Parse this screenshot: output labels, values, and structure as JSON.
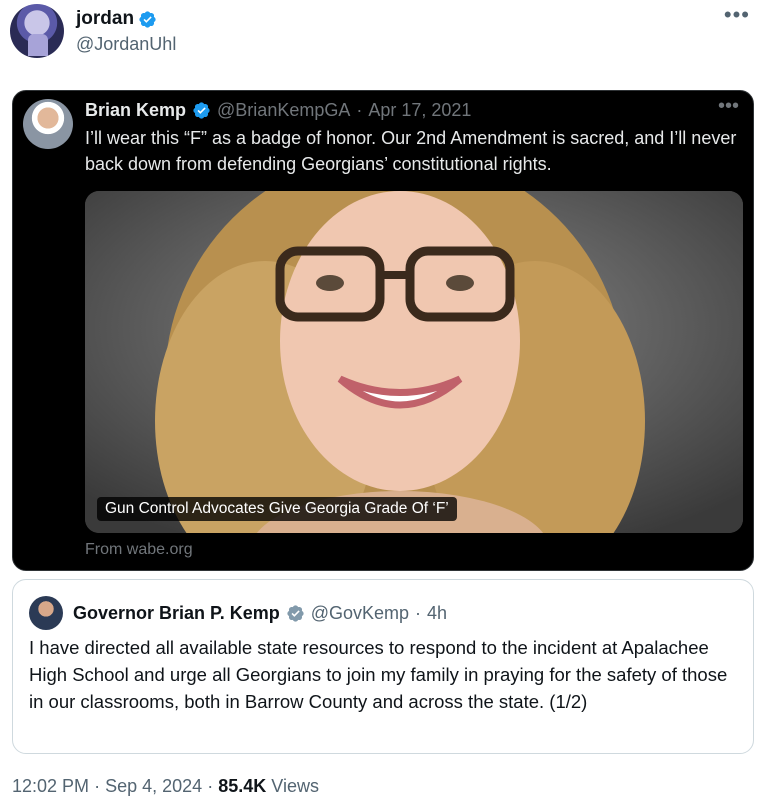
{
  "author": {
    "display_name": "jordan",
    "handle": "@JordanUhl",
    "avatar": "avatar-image",
    "verified_icon": "verified-badge-icon"
  },
  "more_menu": "more-options-icon",
  "quoted_dark": {
    "display_name": "Brian Kemp",
    "handle": "@BrianKempGA",
    "separator": "·",
    "date": "Apr 17, 2021",
    "text": "I’ll wear this “F” as a badge of honor. Our 2nd Amendment is sacred, and I’ll never back down from defending Georgians’ constitutional rights.",
    "image_caption": "Gun Control Advocates Give Georgia Grade Of ‘F’",
    "source": "From wabe.org"
  },
  "quoted_light": {
    "display_name": "Governor Brian P. Kemp",
    "handle": "@GovKemp",
    "separator": "·",
    "time": "4h",
    "text": "I have directed all available state resources to respond to the incident at Apalachee High School and urge all Georgians to join my family in praying for the safety of those in our classrooms, both in Barrow County and across the state. (1/2)"
  },
  "footer": {
    "time": "12:02 PM",
    "sep1": "·",
    "date": "Sep 4, 2024",
    "sep2": "·",
    "views_count": "85.4K",
    "views_label": "Views"
  },
  "colors": {
    "verified_blue": "#1d9bf0",
    "gov_badge_gray": "#829aab",
    "secondary_text": "#536471"
  }
}
